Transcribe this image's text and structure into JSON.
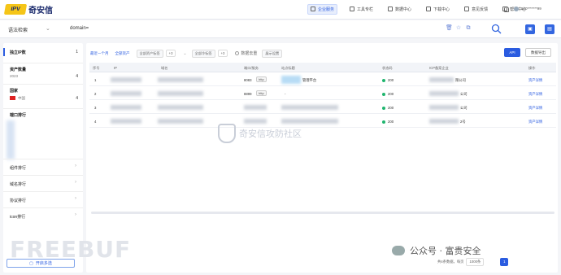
{
  "brand": {
    "logo_badge": "IPV",
    "name": "奇安信"
  },
  "topnav": {
    "items": [
      {
        "label": "企业服务",
        "active": true
      },
      {
        "label": "工具专栏",
        "active": false
      },
      {
        "label": "数据中心",
        "active": false
      },
      {
        "label": "下载中心",
        "active": false
      },
      {
        "label": "意见反馈",
        "active": false
      },
      {
        "label": "帮助中心",
        "active": false
      }
    ],
    "user": "180*******99"
  },
  "searchbar": {
    "type_label": "语法检索",
    "query": "domain=",
    "search_icon": "search-icon"
  },
  "sidebar": {
    "sections": [
      {
        "label": "独立IP数",
        "count": "1"
      },
      {
        "label": "资产数量",
        "count": "4"
      },
      {
        "label": "国家",
        "count": "4"
      },
      {
        "label": "端口排行",
        "count": ""
      }
    ],
    "year": "2023",
    "year_count": "4",
    "country": "中国",
    "country_count": "4",
    "rows": [
      "组件排行",
      "域名排行",
      "协议排行",
      "icon排行"
    ],
    "footer_btn": "开启多选"
  },
  "filters": {
    "time": "最近一个月",
    "assets": "全部资产",
    "chip1": "全部资产标签",
    "chip1_count": "+3",
    "chip2": "全部冷标签",
    "chip2_count": "+3",
    "dedup": "数据去重",
    "fields": "展示设置",
    "api_btn": "API",
    "export_btn": "数据导出"
  },
  "table": {
    "headers": [
      "序号",
      "IP",
      "域名",
      "端口/服务",
      "站点标题",
      "状态码",
      "ICP备案企业",
      "操作"
    ],
    "rows": [
      {
        "idx": "1",
        "port": "8083",
        "proto": "http",
        "title": "管理平台",
        "status": "200",
        "icp": "限公司",
        "op": "资产详情"
      },
      {
        "idx": "2",
        "port": "8899",
        "proto": "http",
        "title": "-",
        "status": "200",
        "icp": "公司",
        "op": "资产详情"
      },
      {
        "idx": "3",
        "port": "",
        "proto": "",
        "title": "",
        "status": "200",
        "icp": "公司",
        "op": "资产详情"
      },
      {
        "idx": "4",
        "port": "",
        "proto": "",
        "title": "",
        "status": "200",
        "icp": "2号",
        "op": "资产详情"
      }
    ]
  },
  "watermark": "奇安信攻防社区",
  "pager": {
    "summary": "共4条数据，每页",
    "size": "1000条",
    "page": "1"
  },
  "footer_marks": {
    "freebuf": "FREEBUF",
    "wechat": "公众号 · 富贵安全"
  },
  "colors": {
    "accent": "#2b5ce0",
    "ok": "#1fb56e",
    "brand_yellow": "#f5c518"
  }
}
